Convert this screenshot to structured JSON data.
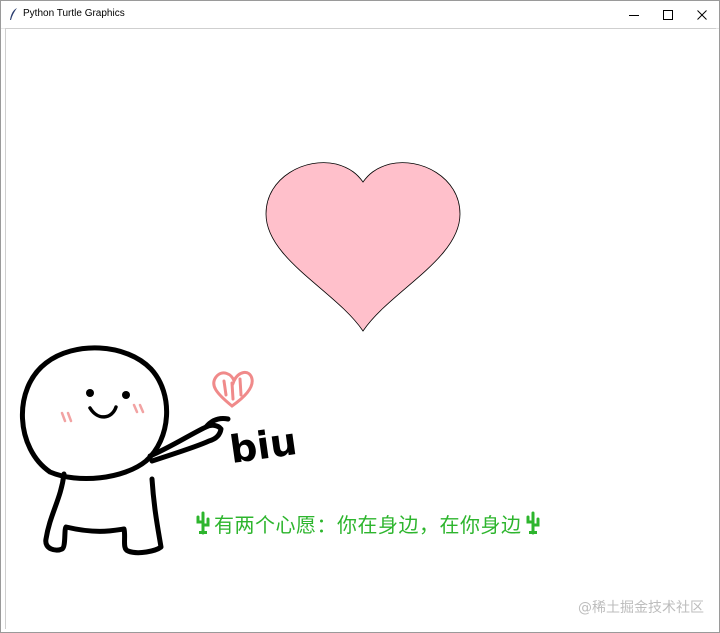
{
  "window": {
    "title": "Python Turtle Graphics",
    "controls": [
      "minimize",
      "maximize",
      "close"
    ]
  },
  "colors": {
    "heart_fill": "#ffc0cb",
    "heart_outline": "#000000",
    "text_green": "#2db52d",
    "watermark": "#bdbdbd",
    "sticker_heart": "#f08a8a",
    "blush": "#f2a3a3"
  },
  "canvas": {
    "sticker_text": "biu",
    "wish_text": "有两个心愿：你在身边，在你身边",
    "watermark": "@稀土掘金技术社区"
  },
  "icons": [
    "feather-icon",
    "minimize-icon",
    "maximize-icon",
    "close-icon",
    "cactus-icon"
  ]
}
